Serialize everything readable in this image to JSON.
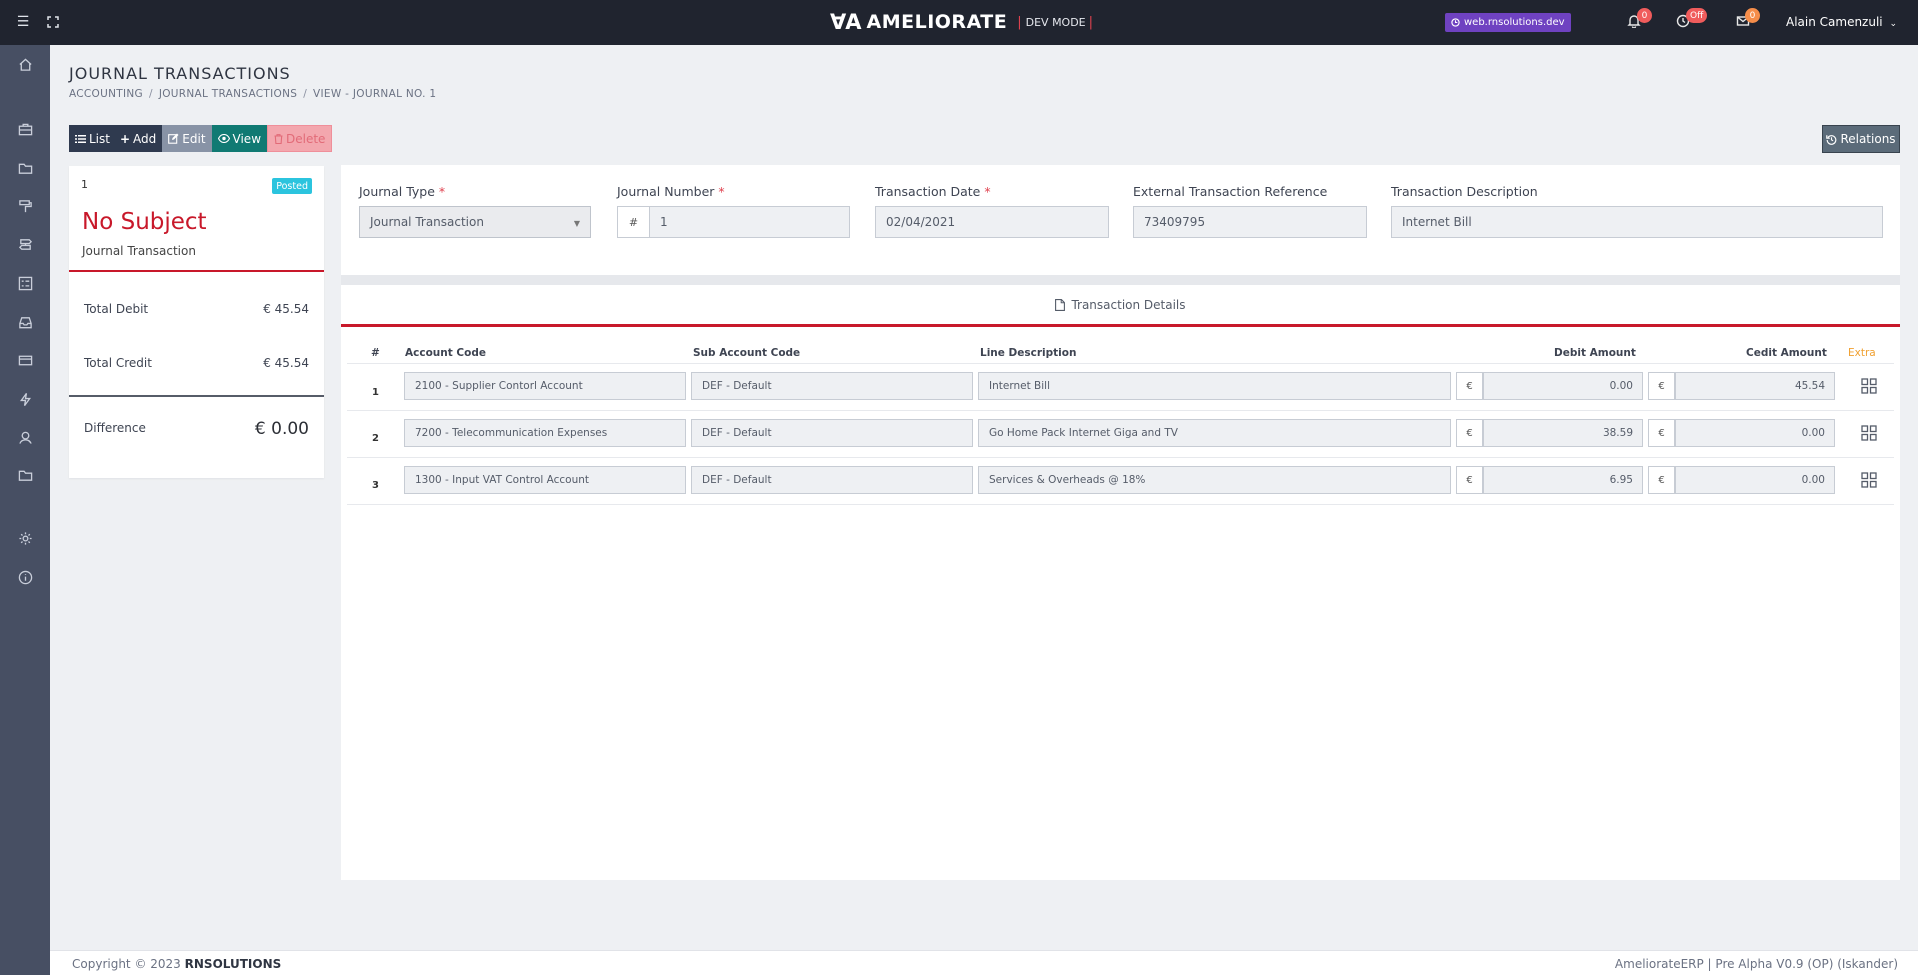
{
  "topbar": {
    "brand_logo": "ꓯA",
    "brand_name": "AMELIORATE",
    "brand_mode": "DEV MODE",
    "site": "web.rnsolutions.dev",
    "notifications_count": "0",
    "clock_status": "Off",
    "messages_count": "0",
    "user_name": "Alain Camenzuli"
  },
  "page": {
    "title": "JOURNAL TRANSACTIONS",
    "breadcrumb": [
      "ACCOUNTING",
      "JOURNAL TRANSACTIONS",
      "VIEW - JOURNAL NO. 1"
    ]
  },
  "toolbar": {
    "list": "List",
    "add": "Add",
    "edit": "Edit",
    "view": "View",
    "delete": "Delete",
    "relations": "Relations"
  },
  "summary": {
    "number": "1",
    "status": "Posted",
    "subject": "No Subject",
    "type": "Journal Transaction",
    "total_debit_label": "Total Debit",
    "total_debit": "€ 45.54",
    "total_credit_label": "Total Credit",
    "total_credit": "€ 45.54",
    "difference_label": "Difference",
    "difference": "€ 0.00"
  },
  "form": {
    "journal_type_label": "Journal Type",
    "journal_type": "Journal Transaction",
    "journal_number_label": "Journal Number",
    "hash": "#",
    "journal_number": "1",
    "transaction_date_label": "Transaction Date",
    "transaction_date": "02/04/2021",
    "external_ref_label": "External Transaction Reference",
    "external_ref": "73409795",
    "description_label": "Transaction Description",
    "description": "Internet Bill",
    "required_mark": "*"
  },
  "details": {
    "tab_label": "Transaction Details",
    "columns": {
      "num": "#",
      "account_code": "Account Code",
      "sub_account_code": "Sub Account Code",
      "line_description": "Line Description",
      "debit_amount": "Debit Amount",
      "credit_amount": "Cedit Amount",
      "extra": "Extra"
    },
    "currency": "€",
    "rows": [
      {
        "num": "1",
        "account": "2100 - Supplier Contorl Account",
        "sub_account": "DEF - Default",
        "description": "Internet Bill",
        "debit": "0.00",
        "credit": "45.54"
      },
      {
        "num": "2",
        "account": "7200 - Telecommunication Expenses",
        "sub_account": "DEF - Default",
        "description": "Go Home Pack Internet Giga and TV",
        "debit": "38.59",
        "credit": "0.00"
      },
      {
        "num": "3",
        "account": "1300 - Input VAT Control Account",
        "sub_account": "DEF - Default",
        "description": "Services & Overheads @ 18%",
        "debit": "6.95",
        "credit": "0.00"
      }
    ]
  },
  "footer": {
    "copyright": "Copyright © 2023",
    "company": "RNSOLUTIONS",
    "version": "AmeliorateERP | Pre Alpha V0.9 (OP) (Iskander)"
  }
}
